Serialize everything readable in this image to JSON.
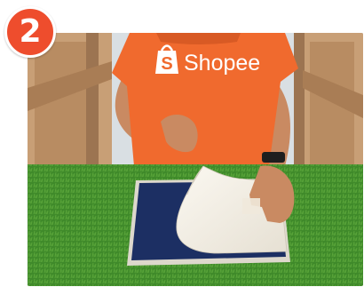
{
  "step": {
    "number": "2"
  },
  "photo": {
    "shirt_logo_text": "Shopee",
    "colors": {
      "badge": "#ee4d2d",
      "shirt": "#f06a2e",
      "turf": "#3f8a2a",
      "navy_fabric": "#1c2f63",
      "transfer_paper": "#f3efe6",
      "wood_wall": "#c89f76"
    }
  }
}
